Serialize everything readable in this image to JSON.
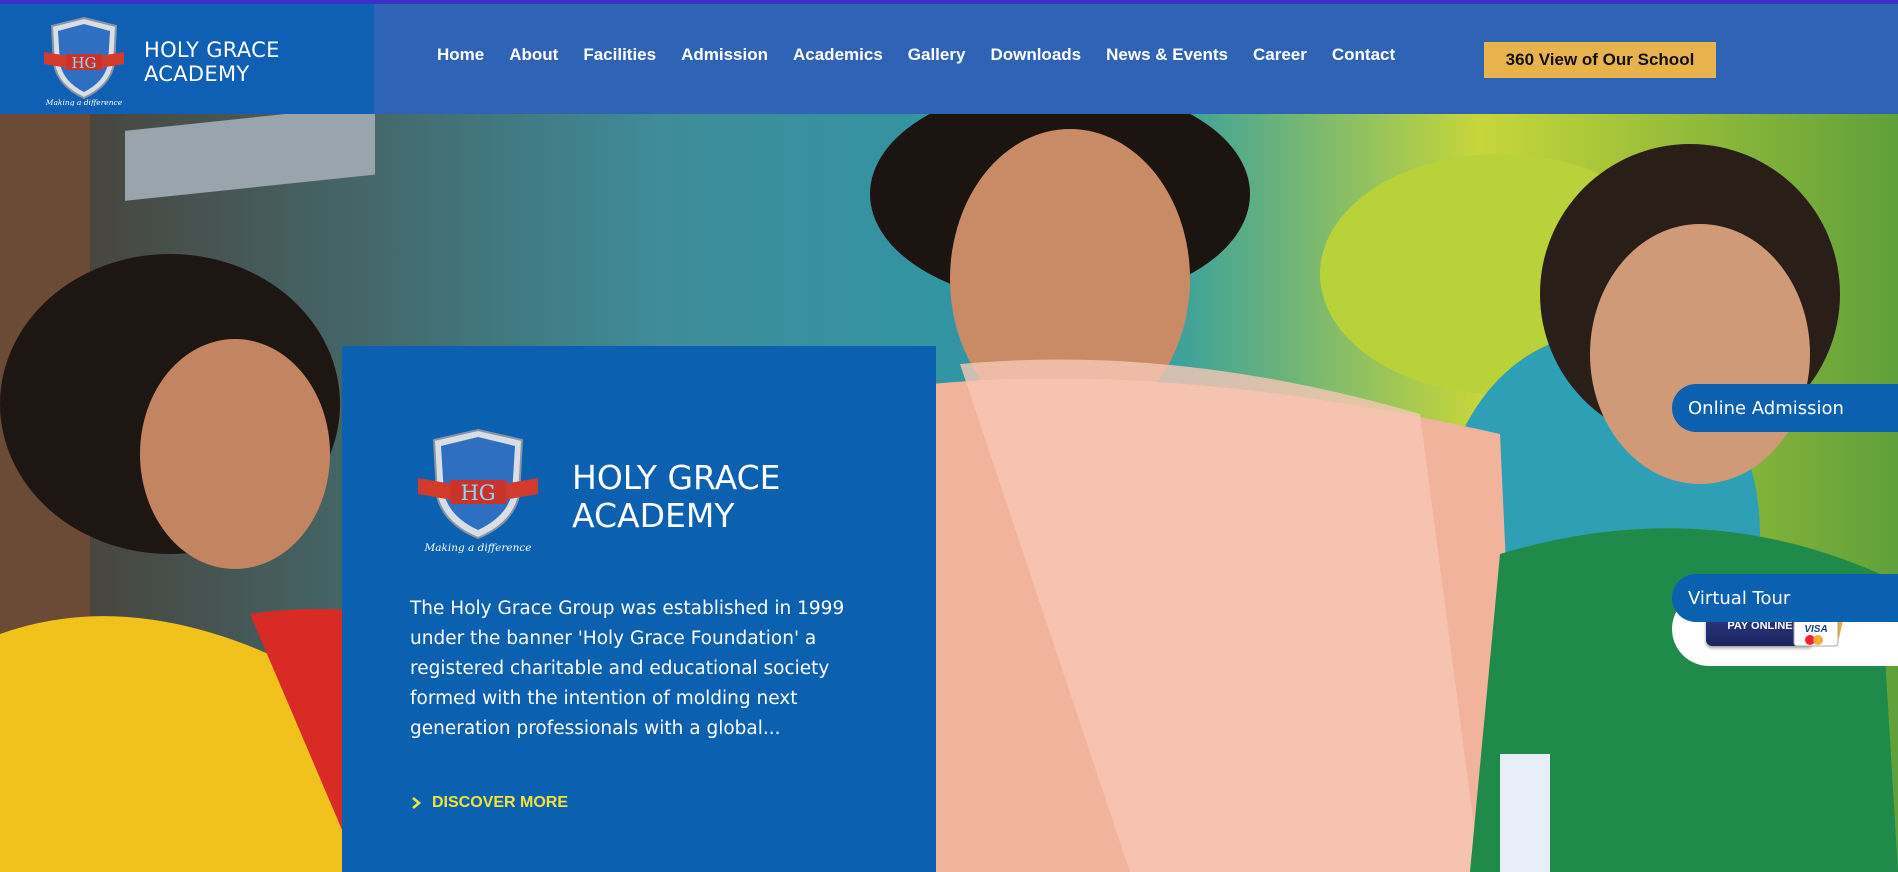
{
  "header": {
    "brand_name_line1": "HOLY GRACE",
    "brand_name_line2": "ACADEMY",
    "logo_tagline": "Making a difference",
    "logo_initials": "HG",
    "nav": [
      "Home",
      "About",
      "Facilities",
      "Admission",
      "Academics",
      "Gallery",
      "Downloads",
      "News & Events",
      "Career",
      "Contact"
    ],
    "cta_label": "360 View of Our School"
  },
  "hero": {
    "card_title_line1": "HOLY GRACE",
    "card_title_line2": "ACADEMY",
    "card_logo_tagline": "Making a difference",
    "description": "The Holy Grace Group was established in 1999 under the banner 'Holy Grace Foundation' a registered charitable and educational society formed with the intention of molding next generation professionals with a global...",
    "discover_label": "DISCOVER MORE"
  },
  "side_tabs": {
    "online_admission": "Online Admission",
    "pay_online": "PAY ONLINE",
    "visa": "VISA",
    "virtual_tour": "Virtual Tour"
  },
  "colors": {
    "header_bg": "#2f63b5",
    "brand_bg": "#0f5fb5",
    "card_bg": "#0b60b0",
    "accent_yellow": "#e8b24d",
    "discover_yellow": "#f3e33a"
  },
  "icons": [
    "shield-logo-icon",
    "arrow-right-icon",
    "credit-card-icon"
  ]
}
